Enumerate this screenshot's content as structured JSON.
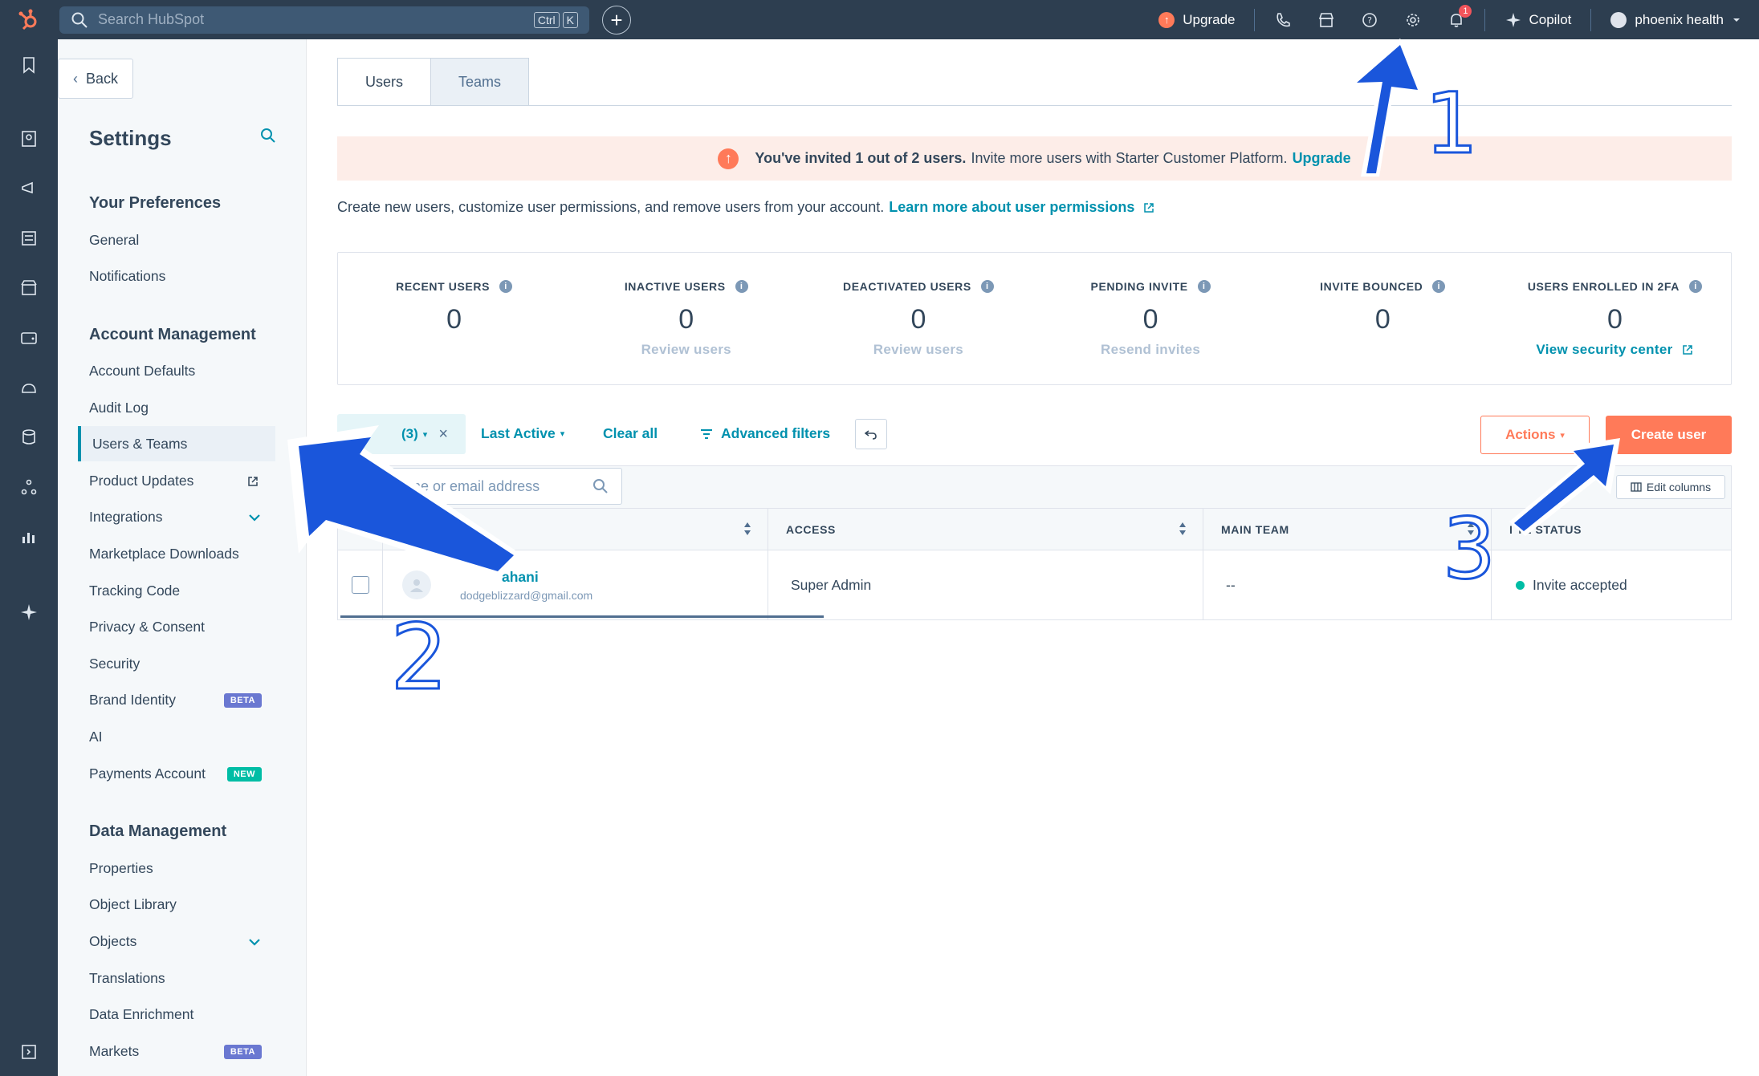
{
  "topbar": {
    "search_placeholder": "Search HubSpot",
    "kbd_ctrl": "Ctrl",
    "kbd_k": "K",
    "upgrade": "Upgrade",
    "copilot": "Copilot",
    "account": "phoenix health",
    "notification_count": "1"
  },
  "sidebar": {
    "back": "Back",
    "title": "Settings",
    "groups": {
      "preferences": "Your Preferences",
      "account": "Account Management",
      "data": "Data Management"
    },
    "items": {
      "general": "General",
      "notifications": "Notifications",
      "account_defaults": "Account Defaults",
      "audit_log": "Audit Log",
      "users_teams": "Users & Teams",
      "product_updates": "Product Updates",
      "integrations": "Integrations",
      "marketplace": "Marketplace Downloads",
      "tracking": "Tracking Code",
      "privacy": "Privacy & Consent",
      "security": "Security",
      "brand": "Brand Identity",
      "ai": "AI",
      "payments": "Payments Account",
      "properties": "Properties",
      "object_library": "Object Library",
      "objects": "Objects",
      "translations": "Translations",
      "enrichment": "Data Enrichment",
      "markets": "Markets"
    },
    "badges": {
      "beta": "BETA",
      "new": "NEW"
    }
  },
  "tabs": {
    "users": "Users",
    "teams": "Teams"
  },
  "banner": {
    "bold": "You've invited 1 out of 2 users.",
    "text": "Invite more users with Starter Customer Platform.",
    "link": "Upgrade"
  },
  "intro": {
    "text": "Create new users, customize user permissions, and remove users from your account.",
    "link": "Learn more about user permissions"
  },
  "stats": [
    {
      "label": "RECENT USERS",
      "value": "0",
      "link": ""
    },
    {
      "label": "INACTIVE USERS",
      "value": "0",
      "link": "Review users"
    },
    {
      "label": "DEACTIVATED USERS",
      "value": "0",
      "link": "Review users"
    },
    {
      "label": "PENDING INVITE",
      "value": "0",
      "link": "Resend invites"
    },
    {
      "label": "INVITE BOUNCED",
      "value": "0",
      "link": ""
    },
    {
      "label": "USERS ENROLLED IN 2FA",
      "value": "0",
      "link": "View security center"
    }
  ],
  "filters": {
    "chip": "(3)",
    "last_active": "Last Active",
    "clear_all": "Clear all",
    "advanced": "Advanced filters",
    "actions": "Actions",
    "create_user": "Create user"
  },
  "table": {
    "search_placeholder": "ch name or email address",
    "edit_columns": "Edit columns",
    "headers": {
      "access": "ACCESS",
      "main_team": "MAIN TEAM",
      "invite_status": "I TE STATUS"
    },
    "rows": [
      {
        "name": "ahani",
        "email": "dodgeblizzard@gmail.com",
        "access": "Super Admin",
        "team": "--",
        "status": "Invite accepted"
      }
    ]
  },
  "annotations": {
    "a1": "1",
    "a2": "2",
    "a3": "3"
  },
  "colors": {
    "accent": "#0091ae",
    "orange": "#ff7a59",
    "nav": "#2d3e50",
    "arrow": "#1a56db"
  }
}
